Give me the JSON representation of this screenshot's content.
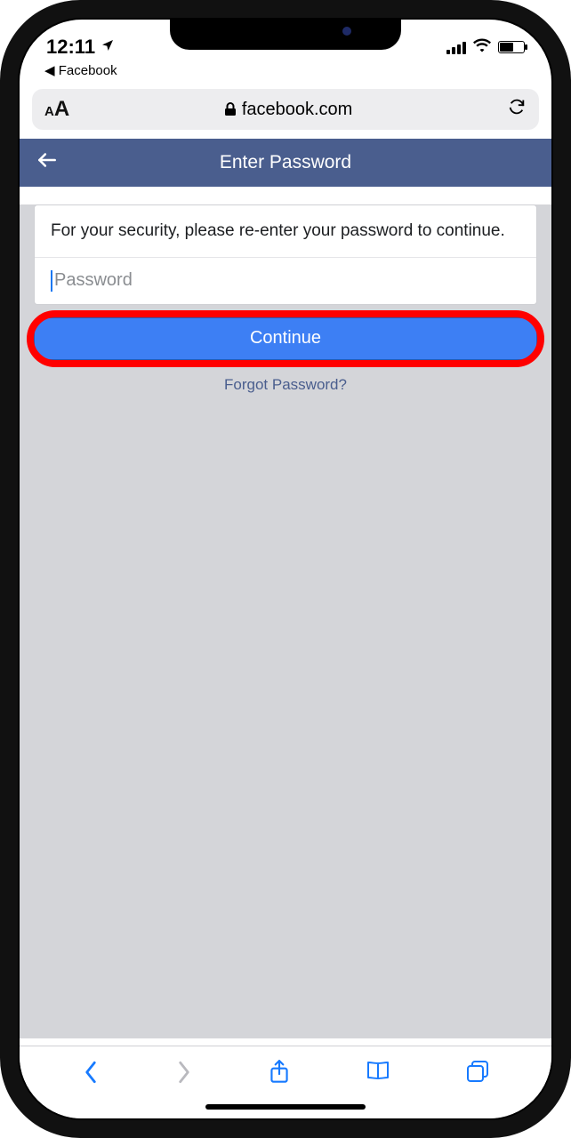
{
  "status": {
    "time": "12:11",
    "breadcrumb_label": "Facebook"
  },
  "safari": {
    "domain": "facebook.com"
  },
  "fb_header": {
    "title": "Enter Password"
  },
  "form": {
    "instructions": "For your security, please re-enter your password to continue.",
    "password_placeholder": "Password",
    "continue_label": "Continue",
    "forgot_label": "Forgot Password?"
  }
}
